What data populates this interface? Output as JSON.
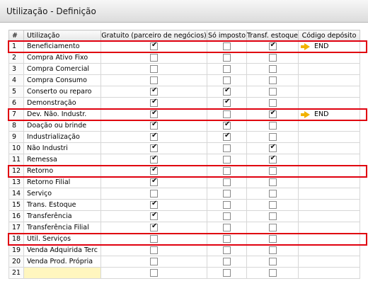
{
  "window": {
    "title": "Utilização - Definição"
  },
  "columns": [
    "#",
    "Utilização",
    "Gratuito (parceiro de negócios)",
    "Só imposto",
    "Transf. estoque",
    "Código depósito"
  ],
  "rows": [
    {
      "num": "1",
      "name": "Beneficiamento",
      "gratuito": true,
      "so_imposto": false,
      "transf": true,
      "deposito": "END",
      "highlight": true
    },
    {
      "num": "2",
      "name": "Compra Ativo Fixo",
      "gratuito": false,
      "so_imposto": false,
      "transf": false,
      "deposito": "",
      "highlight": false
    },
    {
      "num": "3",
      "name": "Compra Comercial",
      "gratuito": false,
      "so_imposto": false,
      "transf": false,
      "deposito": "",
      "highlight": false
    },
    {
      "num": "4",
      "name": "Compra Consumo",
      "gratuito": false,
      "so_imposto": false,
      "transf": false,
      "deposito": "",
      "highlight": false
    },
    {
      "num": "5",
      "name": "Conserto ou reparo",
      "gratuito": true,
      "so_imposto": true,
      "transf": false,
      "deposito": "",
      "highlight": false
    },
    {
      "num": "6",
      "name": "Demonstração",
      "gratuito": true,
      "so_imposto": true,
      "transf": false,
      "deposito": "",
      "highlight": false
    },
    {
      "num": "7",
      "name": "Dev. Não. Industr.",
      "gratuito": true,
      "so_imposto": false,
      "transf": true,
      "deposito": "END",
      "highlight": true
    },
    {
      "num": "8",
      "name": "Doação ou brinde",
      "gratuito": true,
      "so_imposto": true,
      "transf": false,
      "deposito": "",
      "highlight": false
    },
    {
      "num": "9",
      "name": "Industrialização",
      "gratuito": true,
      "so_imposto": true,
      "transf": false,
      "deposito": "",
      "highlight": false
    },
    {
      "num": "10",
      "name": "Não Industri",
      "gratuito": true,
      "so_imposto": false,
      "transf": true,
      "deposito": "",
      "highlight": false
    },
    {
      "num": "11",
      "name": "Remessa",
      "gratuito": true,
      "so_imposto": false,
      "transf": true,
      "deposito": "",
      "highlight": false
    },
    {
      "num": "12",
      "name": "Retorno",
      "gratuito": true,
      "so_imposto": false,
      "transf": false,
      "deposito": "",
      "highlight": true
    },
    {
      "num": "13",
      "name": "Retorno Filial",
      "gratuito": true,
      "so_imposto": false,
      "transf": false,
      "deposito": "",
      "highlight": false
    },
    {
      "num": "14",
      "name": "Serviço",
      "gratuito": false,
      "so_imposto": false,
      "transf": false,
      "deposito": "",
      "highlight": false
    },
    {
      "num": "15",
      "name": "Trans. Estoque",
      "gratuito": true,
      "so_imposto": false,
      "transf": false,
      "deposito": "",
      "highlight": false
    },
    {
      "num": "16",
      "name": "Transferência",
      "gratuito": true,
      "so_imposto": false,
      "transf": false,
      "deposito": "",
      "highlight": false
    },
    {
      "num": "17",
      "name": "Transferência Filial",
      "gratuito": true,
      "so_imposto": false,
      "transf": false,
      "deposito": "",
      "highlight": false
    },
    {
      "num": "18",
      "name": "Util. Serviços",
      "gratuito": false,
      "so_imposto": false,
      "transf": false,
      "deposito": "",
      "highlight": true
    },
    {
      "num": "19",
      "name": "Venda Adquirida Terc",
      "gratuito": false,
      "so_imposto": false,
      "transf": false,
      "deposito": "",
      "highlight": false
    },
    {
      "num": "20",
      "name": "Venda Prod. Própria",
      "gratuito": false,
      "so_imposto": false,
      "transf": false,
      "deposito": "",
      "highlight": false
    },
    {
      "num": "21",
      "name": "",
      "gratuito": false,
      "so_imposto": false,
      "transf": false,
      "deposito": "",
      "highlight": false
    }
  ],
  "colors": {
    "highlight": "#e0000f",
    "arrow": "#f2b200",
    "new_row": "#fff6bf"
  },
  "icons": {
    "checked": "check-icon",
    "deposit": "arrow-right-icon"
  }
}
